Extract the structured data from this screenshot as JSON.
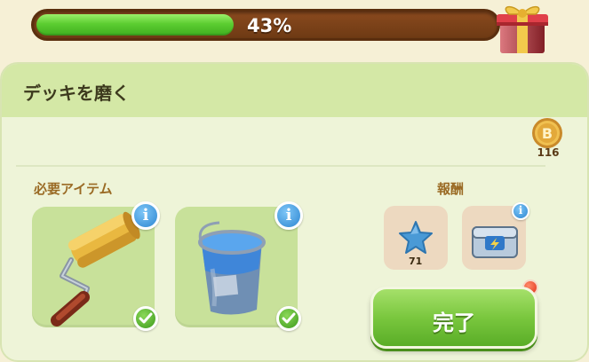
{
  "progress": {
    "percent_label": "43%",
    "fraction": 0.43,
    "fill_color": "#5ccd31",
    "track_color": "#7a4118"
  },
  "gift": {
    "icon": "gift-box-icon"
  },
  "panel": {
    "title": "デッキを磨く",
    "coin": {
      "icon": "coin-icon",
      "count": "116"
    }
  },
  "required_items": {
    "label": "必要アイテム",
    "items": [
      {
        "name": "paint roller",
        "icon": "paint-roller-icon",
        "status": "check-icon"
      },
      {
        "name": "paint bucket",
        "icon": "paint-bucket-icon",
        "status": "check-icon"
      }
    ]
  },
  "rewards": {
    "label": "報酬",
    "items": [
      {
        "icon": "star-icon",
        "count": "71"
      },
      {
        "icon": "energy-chest-icon"
      }
    ]
  },
  "actions": {
    "complete_label": "完了",
    "notify_color": "#e2341c"
  }
}
